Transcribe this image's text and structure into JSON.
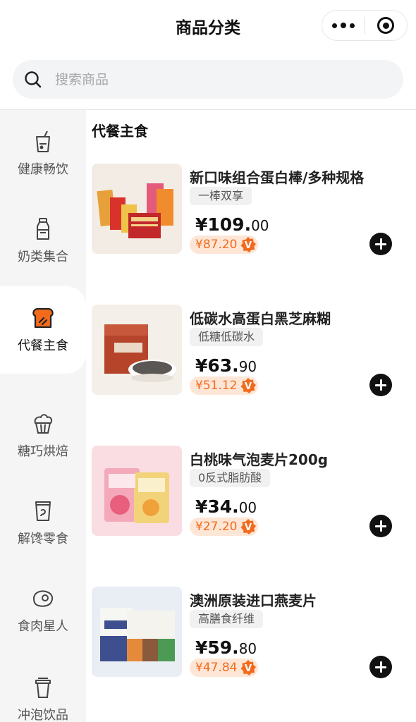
{
  "header": {
    "title": "商品分类"
  },
  "search": {
    "placeholder": "搜索商品"
  },
  "colors": {
    "accent": "#f26b1d",
    "vip_bg": "#fde6d6",
    "sidebar_bg": "#f5f5f5"
  },
  "sidebar": {
    "items": [
      {
        "label": "健康畅饮",
        "icon": "drink-cup-icon",
        "active": false
      },
      {
        "label": "奶类集合",
        "icon": "milk-bottle-icon",
        "active": false
      },
      {
        "label": "代餐主食",
        "icon": "toast-bread-icon",
        "active": true
      },
      {
        "label": "糖巧烘焙",
        "icon": "cupcake-icon",
        "active": false
      },
      {
        "label": "解馋零食",
        "icon": "snack-bag-icon",
        "active": false
      },
      {
        "label": "食肉星人",
        "icon": "steak-icon",
        "active": false
      },
      {
        "label": "冲泡饮品",
        "icon": "coffee-cup-icon",
        "active": false
      }
    ]
  },
  "section": {
    "title": "代餐主食"
  },
  "products": [
    {
      "name": "新口味组合蛋白棒/多种规格",
      "tag": "一棒双享",
      "price_main": "¥109.",
      "price_cents": "00",
      "vip_price": "¥87.20",
      "vip_badge": "V"
    },
    {
      "name": "低碳水高蛋白黑芝麻糊",
      "tag": "低糖低碳水",
      "price_main": "¥63.",
      "price_cents": "90",
      "vip_price": "¥51.12",
      "vip_badge": "V"
    },
    {
      "name": "白桃味气泡麦片200g",
      "tag": "0反式脂肪酸",
      "price_main": "¥34.",
      "price_cents": "00",
      "vip_price": "¥27.20",
      "vip_badge": "V"
    },
    {
      "name": "澳洲原装进口燕麦片",
      "tag": "高膳食纤维",
      "price_main": "¥59.",
      "price_cents": "80",
      "vip_price": "¥47.84",
      "vip_badge": "V"
    }
  ]
}
